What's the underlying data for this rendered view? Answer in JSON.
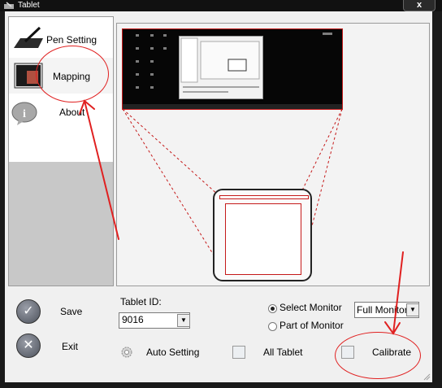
{
  "window": {
    "title": "Tablet",
    "close_label": "x"
  },
  "sidebar": {
    "items": [
      {
        "label": "Pen Setting",
        "icon": "pen-tablet-icon"
      },
      {
        "label": "Mapping",
        "icon": "mapping-icon"
      },
      {
        "label": "About",
        "icon": "info-bubble-icon"
      }
    ]
  },
  "controls": {
    "tablet_id_label": "Tablet ID:",
    "tablet_id_value": "9016",
    "monitor_options": [
      {
        "label": "Select Monitor",
        "selected": true
      },
      {
        "label": "Part of Monitor",
        "selected": false
      }
    ],
    "monitor_select_value": "Full Monitor",
    "save_label": "Save",
    "exit_label": "Exit",
    "auto_setting_label": "Auto Setting",
    "all_tablet_label": "All Tablet",
    "calibrate_label": "Calibrate"
  },
  "colors": {
    "annotation_red": "#e02020",
    "mapping_red": "#c51a1a"
  }
}
